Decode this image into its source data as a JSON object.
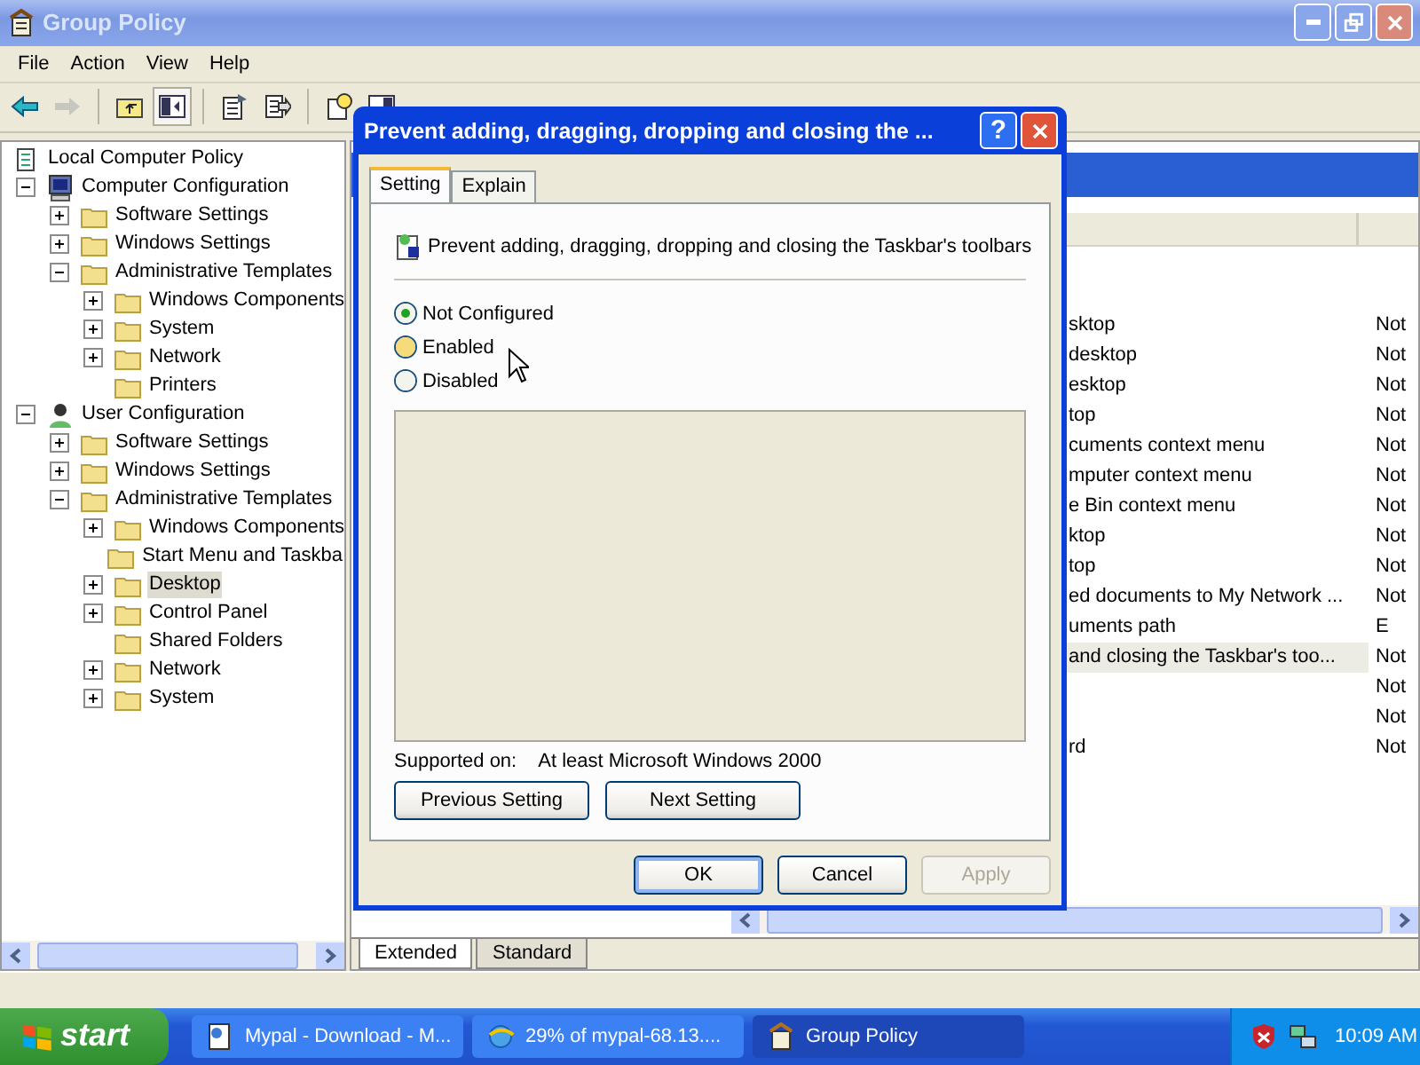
{
  "window": {
    "title": "Group Policy"
  },
  "menu": [
    "File",
    "Action",
    "View",
    "Help"
  ],
  "toolbar": [
    {
      "kind": "back",
      "disabled": false,
      "pressed": false
    },
    {
      "kind": "forward",
      "disabled": true,
      "pressed": false
    },
    {
      "kind": "up",
      "disabled": false,
      "pressed": false
    },
    {
      "kind": "tree",
      "disabled": false,
      "pressed": true
    },
    {
      "kind": "properties",
      "disabled": false,
      "pressed": false
    },
    {
      "kind": "export",
      "disabled": false,
      "pressed": false
    },
    {
      "kind": "help",
      "disabled": false,
      "pressed": false
    },
    {
      "kind": "panel",
      "disabled": false,
      "pressed": false
    }
  ],
  "tree": [
    {
      "label": "Local Computer Policy",
      "kind": "policy",
      "selected": false,
      "children": [
        {
          "label": "Computer Configuration",
          "kind": "computer",
          "expanded": true,
          "selected": false,
          "children": [
            {
              "label": "Software Settings",
              "kind": "folder",
              "expanded": false,
              "selected": false
            },
            {
              "label": "Windows Settings",
              "kind": "folder",
              "expanded": false,
              "selected": false
            },
            {
              "label": "Administrative Templates",
              "kind": "folder",
              "expanded": true,
              "selected": false,
              "children": [
                {
                  "label": "Windows Components",
                  "kind": "folder",
                  "expanded": false,
                  "selected": false
                },
                {
                  "label": "System",
                  "kind": "folder",
                  "expanded": false,
                  "selected": false
                },
                {
                  "label": "Network",
                  "kind": "folder",
                  "expanded": false,
                  "selected": false
                },
                {
                  "label": "Printers",
                  "kind": "folder",
                  "selected": false
                }
              ]
            }
          ]
        },
        {
          "label": "User Configuration",
          "kind": "user",
          "expanded": true,
          "selected": false,
          "children": [
            {
              "label": "Software Settings",
              "kind": "folder",
              "expanded": false,
              "selected": false
            },
            {
              "label": "Windows Settings",
              "kind": "folder",
              "expanded": false,
              "selected": false
            },
            {
              "label": "Administrative Templates",
              "kind": "folder",
              "expanded": true,
              "selected": false,
              "children": [
                {
                  "label": "Windows Components",
                  "kind": "folder",
                  "expanded": false,
                  "selected": false
                },
                {
                  "label": "Start Menu and Taskba",
                  "kind": "folder",
                  "selected": false
                },
                {
                  "label": "Desktop",
                  "kind": "folder",
                  "expanded": false,
                  "selected": true
                },
                {
                  "label": "Control Panel",
                  "kind": "folder",
                  "expanded": false,
                  "selected": false
                },
                {
                  "label": "Shared Folders",
                  "kind": "folder",
                  "selected": false
                },
                {
                  "label": "Network",
                  "kind": "folder",
                  "expanded": false,
                  "selected": false
                },
                {
                  "label": "System",
                  "kind": "folder",
                  "expanded": false,
                  "selected": false
                }
              ]
            }
          ]
        }
      ]
    }
  ],
  "list_rows": [
    {
      "name": "sktop",
      "state": "Not",
      "selected": false
    },
    {
      "name": "desktop",
      "state": "Not",
      "selected": false
    },
    {
      "name": "esktop",
      "state": "Not",
      "selected": false
    },
    {
      "name": "top",
      "state": "Not",
      "selected": false
    },
    {
      "name": "cuments context menu",
      "state": "Not",
      "selected": false
    },
    {
      "name": "mputer context menu",
      "state": "Not",
      "selected": false
    },
    {
      "name": "e Bin context menu",
      "state": "Not",
      "selected": false
    },
    {
      "name": "ktop",
      "state": "Not",
      "selected": false
    },
    {
      "name": "top",
      "state": "Not",
      "selected": false
    },
    {
      "name": "ed documents to My Network ...",
      "state": "Not",
      "selected": false
    },
    {
      "name": "uments path",
      "state": "E",
      "selected": false
    },
    {
      "name": "and closing the Taskbar's too...",
      "state": "Not",
      "selected": true
    },
    {
      "state": "Not",
      "selected": false
    },
    {
      "state": "Not",
      "selected": false
    },
    {
      "name": "rd",
      "state": "Not",
      "selected": false
    }
  ],
  "view_tabs": [
    {
      "label": "Extended",
      "selected": true
    },
    {
      "label": "Standard",
      "selected": false
    }
  ],
  "dialog": {
    "title": "Prevent adding, dragging, dropping and closing the ...",
    "help_glyph": "?",
    "tabs": [
      {
        "label": "Setting",
        "selected": true
      },
      {
        "label": "Explain",
        "selected": false
      }
    ],
    "heading": "Prevent adding, dragging, dropping and closing the Taskbar's toolbars",
    "options": [
      {
        "label": "Not Configured",
        "selected": true,
        "hovered": false
      },
      {
        "label": "Enabled",
        "selected": false,
        "hovered": true
      },
      {
        "label": "Disabled",
        "selected": false,
        "hovered": false
      }
    ],
    "supported_label": "Supported on:",
    "supported_value": "At least Microsoft Windows 2000",
    "nav_buttons": [
      "Previous Setting",
      "Next Setting"
    ],
    "buttons": [
      {
        "label": "OK",
        "default": true,
        "disabled": false
      },
      {
        "label": "Cancel",
        "default": false,
        "disabled": false
      },
      {
        "label": "Apply",
        "default": false,
        "disabled": true
      }
    ]
  },
  "taskbar": {
    "start": "start",
    "tasks": [
      {
        "label": "Mypal - Download - M...",
        "kind": "page",
        "selected": false
      },
      {
        "label": "29% of mypal-68.13....",
        "kind": "globe",
        "selected": false
      },
      {
        "label": "Group Policy",
        "kind": "policy",
        "selected": true
      }
    ],
    "clock": "10:09 AM"
  }
}
